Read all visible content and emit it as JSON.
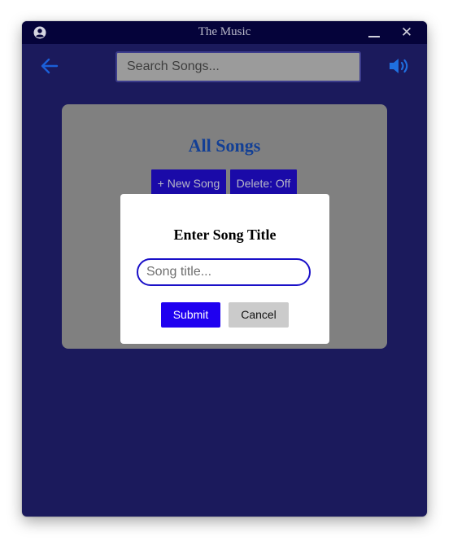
{
  "window": {
    "title": "The Music"
  },
  "toolbar": {
    "search_placeholder": "Search Songs..."
  },
  "panel": {
    "heading": "All Songs",
    "new_song_label": "+ New Song",
    "delete_toggle_label": "Delete: Off"
  },
  "dialog": {
    "title": "Enter Song Title",
    "input_placeholder": "Song title...",
    "submit_label": "Submit",
    "cancel_label": "Cancel"
  },
  "colors": {
    "window_bg": "#1b1a5c",
    "titlebar_bg": "#05033a",
    "accent_blue": "#1f6fe0",
    "panel_bg": "#808080",
    "button_bg": "#1a0aa8",
    "submit_bg": "#1f00f0"
  },
  "icons": {
    "account": "user-circle-icon",
    "back": "arrow-left-icon",
    "volume": "volume-icon",
    "minimize": "minimize-icon",
    "close": "close-icon"
  }
}
